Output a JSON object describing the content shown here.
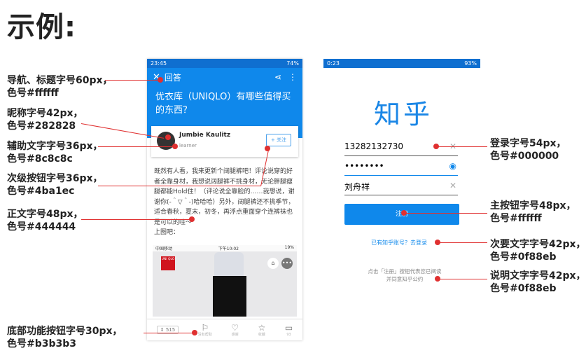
{
  "title": "示例:",
  "annotations": [
    {
      "key": "nav",
      "line1": "导航、标题字号60px，",
      "line2": "色号#ffffff"
    },
    {
      "key": "nick",
      "line1": "昵称字号42px，",
      "line2": "色号#282828"
    },
    {
      "key": "aux",
      "line1": "辅助文字字号36px，",
      "line2": "色号#8c8c8c"
    },
    {
      "key": "btn2",
      "line1": "次级按钮字号36px，",
      "line2": "色号#4ba1ec"
    },
    {
      "key": "body",
      "line1": "正文字号48px，",
      "line2": "色号#444444"
    },
    {
      "key": "bottom",
      "line1": "底部功能按钮字号30px，",
      "line2": "色号#b3b3b3"
    },
    {
      "key": "login",
      "line1": "登录字号54px，",
      "line2": "色号#000000"
    },
    {
      "key": "main",
      "line1": "主按钮字号48px，",
      "line2": "色号#ffffff"
    },
    {
      "key": "minor",
      "line1": "次要文字字号42px，",
      "line2": "色号#0f88eb"
    },
    {
      "key": "desc",
      "line1": "说明文字字号42px，",
      "line2": "色号#0f88eb"
    }
  ],
  "phone1": {
    "status_time": "23:45",
    "status_right": "74%",
    "nav_title": "回答",
    "question": "优衣库（UNIQLO）有哪些值得买的东西？",
    "author": "Jumbie Kaulitz",
    "author_sub": "learner",
    "follow": "+ 关注",
    "body": "既然有人看，我来更新个阔腿裤吧！评论说穿的好者全靠身材，我想说阔腿裤不挑身材，无论胖腿瘦腿都能Hold住！（评论说全靠脸的……我想说，谢谢你(-＾▽＾-)哈哈哈）另外，阔腿裤还不挑季节，适合春秋，夏末，初冬，再浮点重面穿个连裤袜也是可以的哇～",
    "body_end": "上图吧：",
    "img_status_left": "中国移动",
    "img_status_mid": "下午10:02",
    "img_status_right": "19%",
    "brand": "UNI QLO",
    "vote": "515",
    "tabs": [
      "没有帮助",
      "感谢",
      "收藏",
      "93"
    ]
  },
  "phone2": {
    "status_time": "0:23",
    "status_right": "93%",
    "logo": "知乎",
    "phone_value": "13282132730",
    "password_value": "••••••••",
    "name_value": "刘舟祥",
    "register": "注册",
    "link": "已有知乎账号？去登录",
    "desc_line1": "点击「注册」按钮代表您已阅读",
    "desc_line2": "并同意知乎公约"
  },
  "colors": {
    "accent": "#0f88eb",
    "marker": "#e03030"
  }
}
